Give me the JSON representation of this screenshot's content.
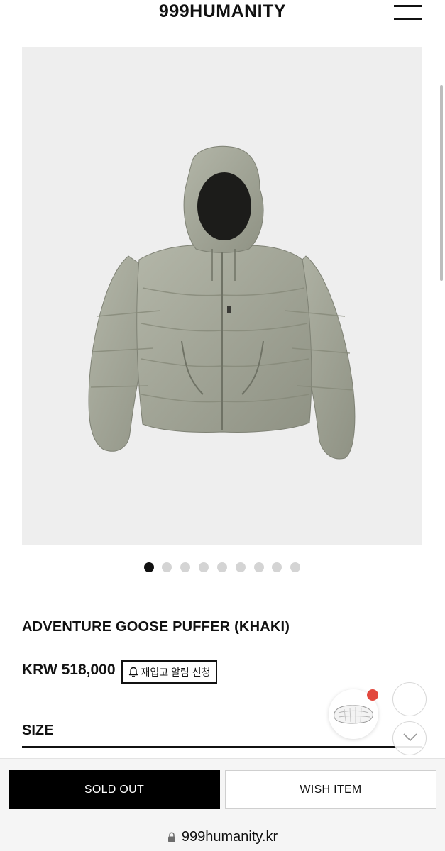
{
  "header": {
    "brand": "999HUMANITY"
  },
  "product": {
    "image_alt_icon": "khaki-hooded-puffer-jacket",
    "carousel": {
      "total": 9,
      "active_index": 1
    },
    "title": "ADVENTURE GOOSE PUFFER (KHAKI)",
    "price": "KRW 518,000",
    "restock_label": "재입고 알림 신청",
    "size_label": "SIZE"
  },
  "actions": {
    "sold_out_label": "SOLD OUT",
    "wish_label": "WISH ITEM"
  },
  "browser": {
    "url": "999humanity.kr"
  },
  "colors": {
    "accent_black": "#000000",
    "notification_red": "#e2483d",
    "jacket_khaki": "#a5a89a"
  }
}
